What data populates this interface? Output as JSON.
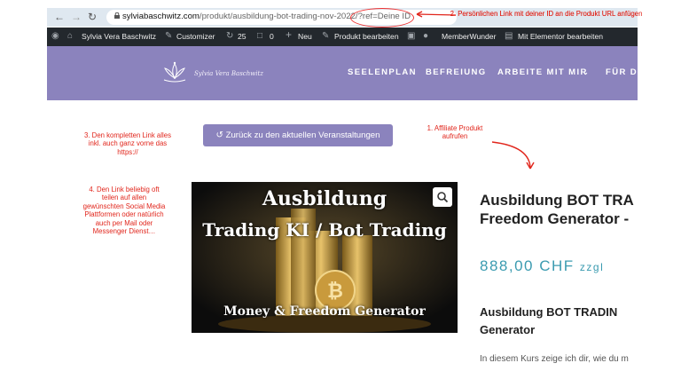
{
  "browser": {
    "url_domain": "sylviabaschwitz.com",
    "url_path": "/produkt/ausbildung-bot-trading-nov-2022/?ref=Deine ID",
    "back_icon": "arrow-left-icon",
    "forward_icon": "arrow-right-icon",
    "reload_icon": "reload-icon"
  },
  "admin_bar": {
    "site_name": "Sylvia Vera Baschwitz",
    "customizer": "Customizer",
    "updates_count": "25",
    "comments_count": "0",
    "new": "Neu",
    "edit_product": "Produkt bearbeiten",
    "member": "MemberWunder",
    "elementor": "Mit Elementor bearbeiten"
  },
  "header": {
    "logo_text": "Sylvia Vera Baschwitz",
    "nav": [
      "SEELENPLAN",
      "BEFREIUNG",
      "ARBEITE MIT MIR",
      "FÜR DI"
    ]
  },
  "back_button": "Zurück zu den aktuellen Veranstaltungen",
  "annotations": {
    "a1": "1. Affiliate Produkt aufrufen",
    "a2": "2. Persönlichen Link mit deiner ID an die Produkt URL anfügen",
    "a3": "3. Den kompletten Link alles inkl. auch ganz vorne das https://",
    "a4": "4. Den Link beliebig oft teilen auf allen gewünschten Social Media Plattformen oder natürlich auch per Mail oder Messenger Dienst…"
  },
  "product_image": {
    "line1": "Ausbildung",
    "line2": "Trading KI / Bot Trading",
    "line3": "Money & Freedom Generator"
  },
  "product": {
    "title_line1": "Ausbildung BOT TRA",
    "title_line2": "Freedom Generator -",
    "price": "888,00 CHF",
    "price_suffix": "zzgl",
    "heading_line1": "Ausbildung BOT TRADIN",
    "heading_line2": "Generator",
    "intro": "In diesem Kurs zeige ich dir, wie du m"
  },
  "colors": {
    "header_purple": "#8b83bd",
    "annotation_red": "#e1261c",
    "price_teal": "#3b9bb0"
  }
}
